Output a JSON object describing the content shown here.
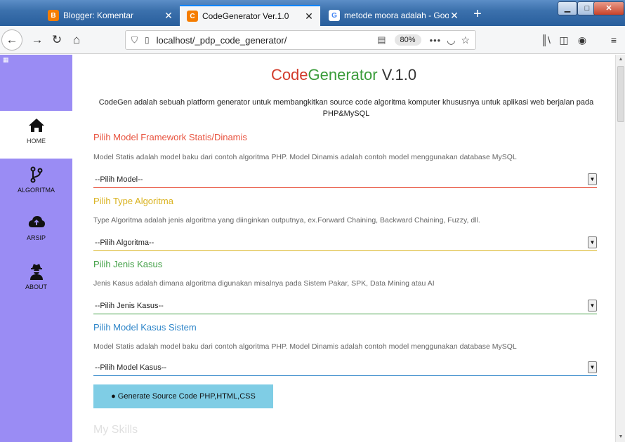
{
  "browser": {
    "tabs": [
      {
        "title": "Blogger: Komentar",
        "favicon": "blogger-icon",
        "active": false
      },
      {
        "title": "CodeGenerator Ver.1.0",
        "favicon": "codegen-icon",
        "active": true
      },
      {
        "title": "metode moora adalah - Googl",
        "favicon": "google-icon",
        "active": false
      }
    ],
    "url": "localhost/_pdp_code_generator/",
    "zoom": "80%"
  },
  "sidebar": {
    "items": [
      {
        "label": "HOME",
        "icon": "home-icon"
      },
      {
        "label": "ALGORITMA",
        "icon": "code-branch-icon"
      },
      {
        "label": "ARSIP",
        "icon": "cloud-upload-icon"
      },
      {
        "label": "ABOUT",
        "icon": "user-secret-icon"
      }
    ]
  },
  "main": {
    "title_part1": "Code",
    "title_part2": "Generator",
    "title_part3": " V.1.0",
    "description": "CodeGen adalah sebuah platform generator untuk membangkitkan source code algoritma komputer khususnya untuk aplikasi web berjalan pada PHP&MySQL",
    "sections": [
      {
        "heading": "Pilih Model Framework Statis/Dinamis",
        "color": "#e8533f",
        "text": "Model Statis adalah model baku dari contoh algoritma PHP. Model Dinamis adalah contoh model menggunakan database MySQL",
        "select": "--Pilih Model--"
      },
      {
        "heading": "Pilih Type Algoritma",
        "color": "#d9b21e",
        "text": "Type Algoritma adalah jenis algoritma yang diinginkan outputnya, ex.Forward Chaining, Backward Chaining, Fuzzy, dll.",
        "select": "--Pilih Algoritma--"
      },
      {
        "heading": "Pilih Jenis Kasus",
        "color": "#43a047",
        "text": "Jenis Kasus adalah dimana algoritma digunakan misalnya pada Sistem Pakar, SPK, Data Mining atau AI",
        "select": "--Pilih Jenis Kasus--"
      },
      {
        "heading": "Pilih Model Kasus Sistem",
        "color": "#2f86c9",
        "text": "Model Statis adalah model baku dari contoh algoritma PHP. Model Dinamis adalah contoh model menggunakan database MySQL",
        "select": "--Pilih Model Kasus--"
      }
    ],
    "generate_button": "Generate Source Code PHP,HTML,CSS",
    "skills_heading": "My Skills"
  }
}
